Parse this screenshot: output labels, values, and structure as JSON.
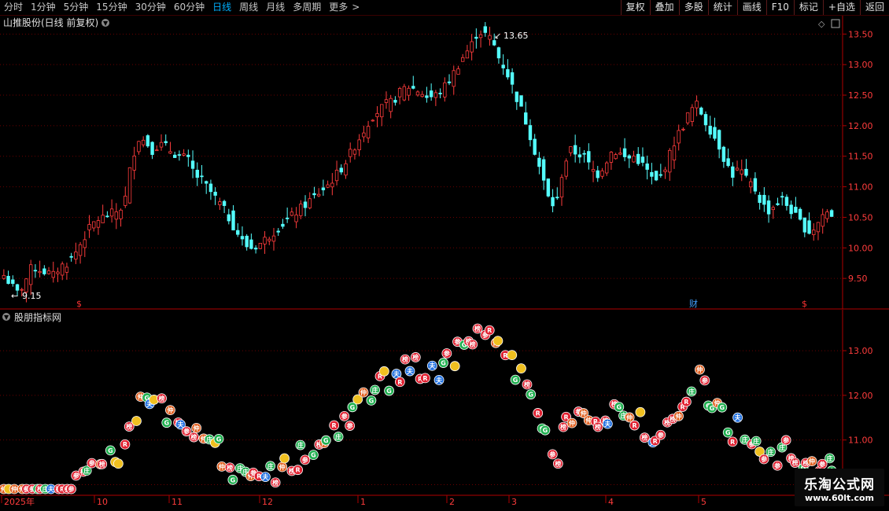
{
  "toolbar": {
    "tabs": [
      "分时",
      "1分钟",
      "5分钟",
      "15分钟",
      "30分钟",
      "60分钟",
      "日线",
      "周线",
      "月线",
      "多周期",
      "更多"
    ],
    "active_tab": "日线",
    "right_buttons": [
      "复权",
      "叠加",
      "多股",
      "统计",
      "画线",
      "F10",
      "标记",
      "+自选",
      "返回"
    ]
  },
  "main_panel": {
    "title": "山推股份(日线 前复权)",
    "high_label": "13.65",
    "low_label": "9.15",
    "markers": [
      "$",
      "财",
      "$"
    ]
  },
  "indicator_panel": {
    "title": "股朋指标网"
  },
  "watermark": {
    "line1": "乐淘公式网",
    "line2": "www.60lt.com"
  },
  "colors": {
    "up": "#ff3c3c",
    "down": "#54ffff",
    "axis": "#b00000",
    "active_tab": "#00b0ff"
  },
  "chart_data": [
    {
      "type": "candlestick",
      "title": "山推股份(日线 前复权)",
      "ylim": [
        9.0,
        13.8
      ],
      "y_ticks": [
        9.5,
        10.0,
        10.5,
        11.0,
        11.5,
        12.0,
        12.5,
        13.0,
        13.5
      ],
      "x_ticks": [
        "2025年",
        "10",
        "11",
        "12",
        "1",
        "2",
        "3",
        "4",
        "5"
      ],
      "annotations": [
        {
          "text": "13.65",
          "kind": "max"
        },
        {
          "text": "9.15",
          "kind": "min"
        }
      ],
      "close_path": [
        9.55,
        9.4,
        9.25,
        9.45,
        9.7,
        9.65,
        9.6,
        9.55,
        9.7,
        9.75,
        9.9,
        10.1,
        10.3,
        10.45,
        10.5,
        10.55,
        10.6,
        10.7,
        11.4,
        11.8,
        11.75,
        11.6,
        11.7,
        11.65,
        11.55,
        11.5,
        11.45,
        11.2,
        11.1,
        10.95,
        10.8,
        10.65,
        10.45,
        10.25,
        10.05,
        10.0,
        10.05,
        10.15,
        10.25,
        10.35,
        10.45,
        10.55,
        10.65,
        10.75,
        10.85,
        10.95,
        11.05,
        11.2,
        11.35,
        11.55,
        11.75,
        11.95,
        12.15,
        12.25,
        12.35,
        12.4,
        12.55,
        12.65,
        12.6,
        12.55,
        12.45,
        12.5,
        12.6,
        12.75,
        12.95,
        13.15,
        13.3,
        13.55,
        13.5,
        13.4,
        13.1,
        12.9,
        12.6,
        12.3,
        12.0,
        11.6,
        11.2,
        10.8,
        10.65,
        11.3,
        11.6,
        11.55,
        11.5,
        11.3,
        11.2,
        11.4,
        11.6,
        11.55,
        11.45,
        11.5,
        11.4,
        11.25,
        11.05,
        11.2,
        11.5,
        11.8,
        12.0,
        12.25,
        12.35,
        12.1,
        11.9,
        11.7,
        11.4,
        11.2,
        11.3,
        11.1,
        11.0,
        10.75,
        10.6,
        10.7,
        10.8,
        10.65,
        10.5,
        10.35,
        10.25,
        10.4,
        10.6,
        10.55
      ]
    },
    {
      "type": "scatter",
      "title": "股朋指标网",
      "ylim": [
        9.85,
        13.6
      ],
      "y_ticks": [
        10.0,
        11.0,
        12.0,
        13.0
      ],
      "series": [
        {
          "values_follow": "close_path"
        }
      ]
    }
  ]
}
